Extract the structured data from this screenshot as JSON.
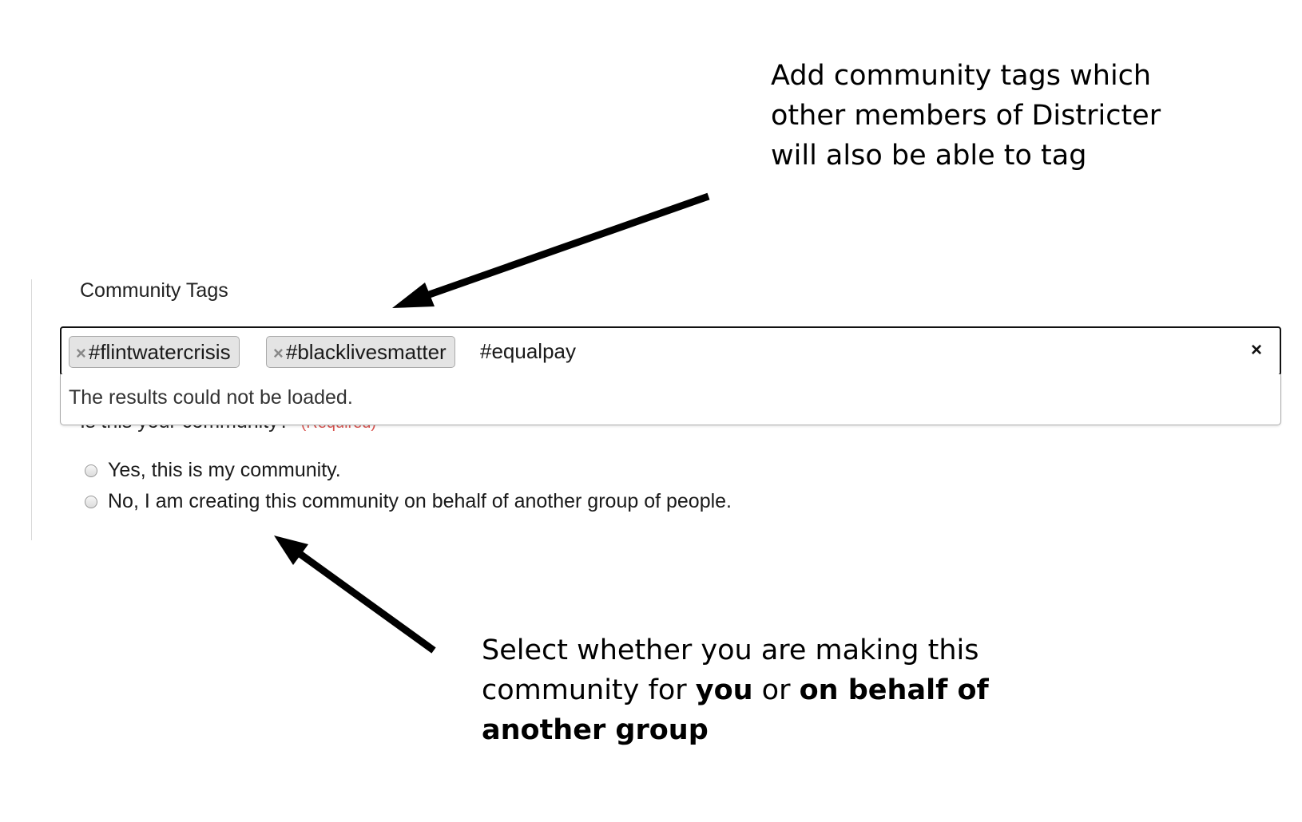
{
  "annotations": {
    "top": {
      "line1": "Add community tags which",
      "line2": "other members of Districter",
      "line3": "will also be able to tag"
    },
    "bottom": {
      "line1": "Select whether you are making this",
      "line2_prefix": "community for ",
      "line2_bold_a": "you",
      "line2_mid": " or ",
      "line2_bold_b": "on behalf of",
      "line3_bold": "another group"
    }
  },
  "community_tags": {
    "label": "Community Tags",
    "tags": [
      {
        "remove_glyph": "×",
        "label": "#flintwatercrisis"
      },
      {
        "remove_glyph": "×",
        "label": "#blacklivesmatter"
      }
    ],
    "search_value": "#equalpay",
    "clear_glyph": "×",
    "dropdown_message": "The results could not be loaded."
  },
  "ownership_question": {
    "label": "Is this your community?",
    "required_text": "(Required)",
    "options": [
      {
        "label": "Yes, this is my community."
      },
      {
        "label": "No, I am creating this community on behalf of another group of people."
      }
    ]
  }
}
